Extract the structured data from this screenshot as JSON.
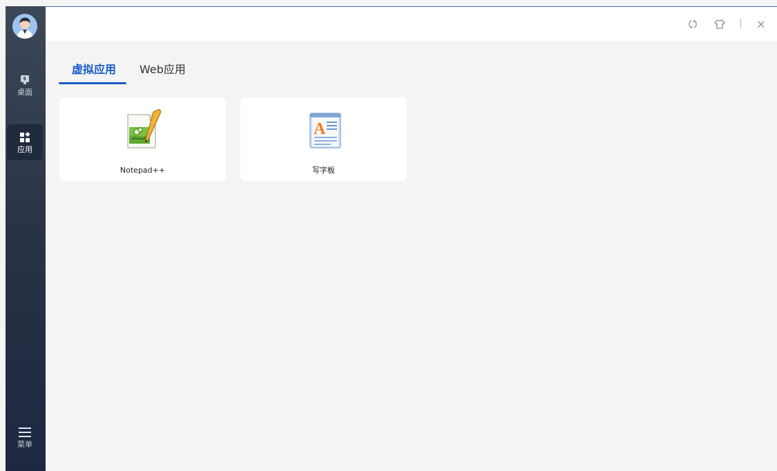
{
  "sidebar": {
    "items": [
      {
        "label": "桌面",
        "icon": "desktop-icon"
      },
      {
        "label": "应用",
        "icon": "apps-icon",
        "active": true
      },
      {
        "label": "菜单",
        "icon": "hamburger-menu-icon"
      }
    ]
  },
  "titlebar": {
    "buttons": [
      "refresh-icon",
      "skin-icon",
      "close-icon"
    ]
  },
  "tabs": [
    {
      "label": "虚拟应用",
      "active": true
    },
    {
      "label": "Web应用",
      "active": false
    }
  ],
  "apps": [
    {
      "name": "Notepad++",
      "icon": "notepad-plus-plus-icon"
    },
    {
      "name": "写字板",
      "icon": "wordpad-icon"
    }
  ],
  "colors": {
    "accent": "#1a5bc6",
    "sidebar_top": "#3d4857",
    "sidebar_bottom": "#1d2740",
    "content_bg": "#f4f4f5"
  }
}
